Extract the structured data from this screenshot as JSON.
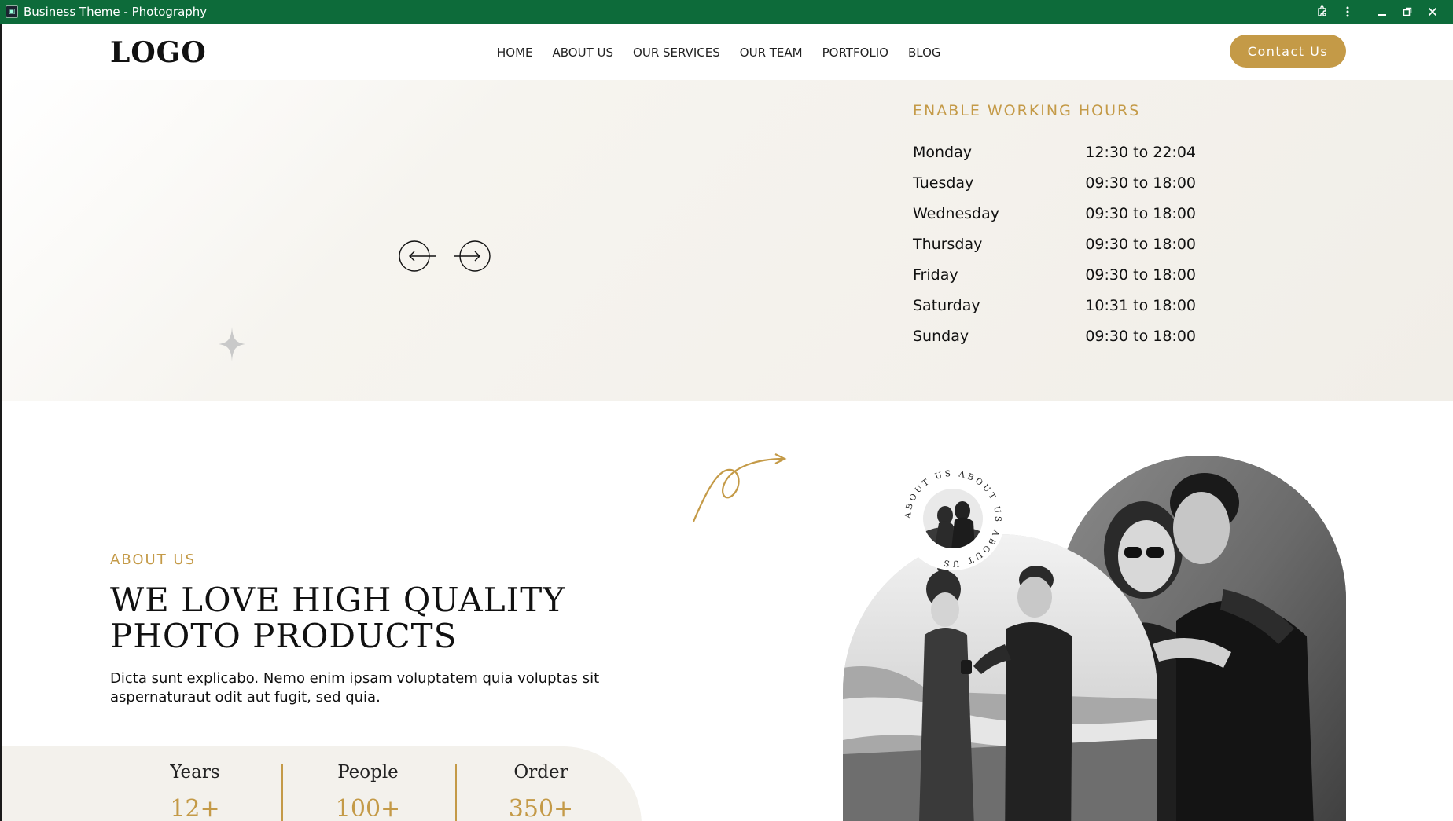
{
  "window": {
    "title": "Business Theme - Photography"
  },
  "header": {
    "logo": "LOGO",
    "nav": [
      "HOME",
      "ABOUT US",
      "OUR SERVICES",
      "OUR TEAM",
      "PORTFOLIO",
      "BLOG"
    ],
    "contact_label": "Contact Us"
  },
  "hours": {
    "title": "ENABLE WORKING HOURS",
    "rows": [
      {
        "day": "Monday",
        "time": "12:30 to 22:04"
      },
      {
        "day": "Tuesday",
        "time": "09:30 to 18:00"
      },
      {
        "day": "Wednesday",
        "time": "09:30 to 18:00"
      },
      {
        "day": "Thursday",
        "time": "09:30 to 18:00"
      },
      {
        "day": "Friday",
        "time": "09:30 to 18:00"
      },
      {
        "day": "Saturday",
        "time": "10:31 to 18:00"
      },
      {
        "day": "Sunday",
        "time": "09:30 to 18:00"
      }
    ]
  },
  "about": {
    "label": "ABOUT US",
    "title_line1": "WE LOVE HIGH QUALITY",
    "title_line2": "PHOTO PRODUCTS",
    "text": "Dicta sunt explicabo. Nemo enim ipsam voluptatem quia voluptas sit aspernaturaut odit aut fugit, sed quia.",
    "badge_text": "ABOUT US ABOUT US ABOUT US"
  },
  "stats": [
    {
      "label": "Years",
      "value": "12+"
    },
    {
      "label": "People",
      "value": "100+"
    },
    {
      "label": "Order",
      "value": "350+"
    }
  ],
  "colors": {
    "accent": "#c49a47",
    "titlebar": "#0d6b3a",
    "hero_bg": "#f3f1ec"
  }
}
